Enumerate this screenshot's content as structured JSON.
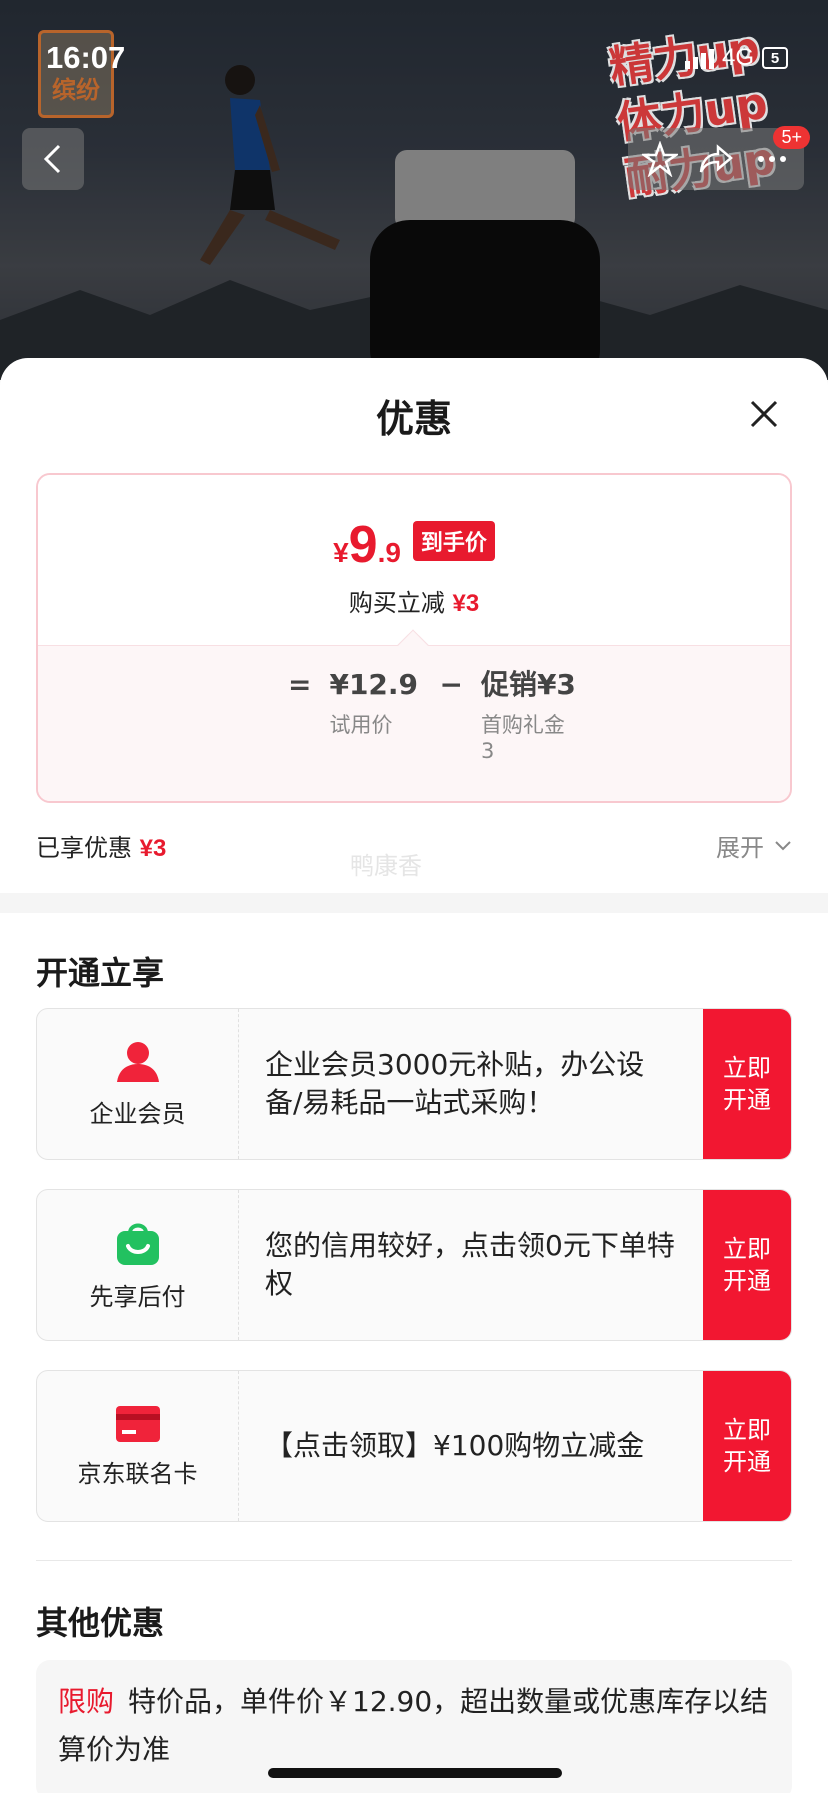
{
  "status_bar": {
    "time": "16:07",
    "network": "4G",
    "battery": "5"
  },
  "hero": {
    "brand_badge": "缤纷",
    "promo_lines": [
      "精力up",
      "体力up",
      "耐力up"
    ],
    "message_badge": "5+"
  },
  "sheet": {
    "title": "优惠",
    "price_card": {
      "currency": "¥",
      "price_int": "9",
      "price_dec": ".9",
      "final_tag": "到手价",
      "reduce_label": "购买立减",
      "reduce_value": "¥3",
      "formula": {
        "eq": "=",
        "base_value": "¥12.9",
        "base_label": "试用价",
        "minus": "−",
        "promo_value": "促销¥3",
        "promo_label": "首购礼金3"
      }
    },
    "enjoyed_label": "已享优惠",
    "enjoyed_value": "¥3",
    "expand_label": "展开",
    "watermark": "鸭康香",
    "open_section_title": "开通立享",
    "open_items": [
      {
        "name": "企业会员",
        "desc": "企业会员3000元补贴，办公设备/易耗品一站式采购！",
        "button": "立即开通",
        "icon": "person-icon",
        "color": "#f0233a"
      },
      {
        "name": "先享后付",
        "desc": "您的信用较好，点击领0元下单特权",
        "button": "立即开通",
        "icon": "shopping-bag-icon",
        "color": "#22c160"
      },
      {
        "name": "京东联名卡",
        "desc": "【点击领取】¥100购物立减金",
        "button": "立即开通",
        "icon": "credit-card-icon",
        "color": "#f0233a"
      }
    ],
    "other_section_title": "其他优惠",
    "other_item": {
      "tag": "限购",
      "text": "特价品，单件价￥12.90，超出数量或优惠库存以结算价为准"
    }
  }
}
